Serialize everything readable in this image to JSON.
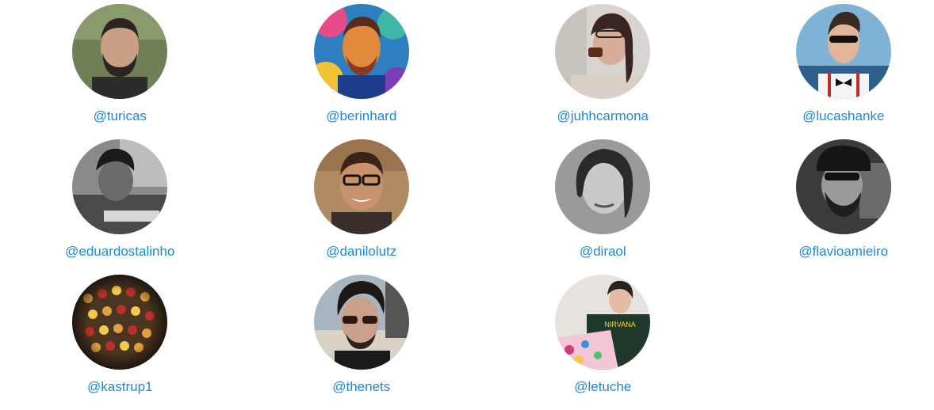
{
  "members": [
    {
      "handle": "@turicas",
      "avatar": "photo-bearded-man-outdoors",
      "bg": "#6f7f58",
      "skin": "#c9a084",
      "hair": "#2b2420"
    },
    {
      "handle": "@berinhard",
      "avatar": "psychedelic-portrait",
      "bg": "#2e7fc2",
      "skin": "#e08a3c",
      "hair": "#5b2a1a"
    },
    {
      "handle": "@juhhcarmona",
      "avatar": "photo-woman-drinking",
      "bg": "#d9d4cf",
      "skin": "#d6ad98",
      "hair": "#3a2520"
    },
    {
      "handle": "@lucashanke",
      "avatar": "photo-man-sunglasses-beach",
      "bg": "#7fb3d6",
      "skin": "#e2b49a",
      "hair": "#3b2a22"
    },
    {
      "handle": "@eduardostalinho",
      "avatar": "bw-photo-man-at-desk",
      "bg": "#8a8a8a",
      "skin": "#6a6a6a",
      "hair": "#1a1a1a"
    },
    {
      "handle": "@danilolutz",
      "avatar": "photo-smiling-man-glasses",
      "bg": "#b08a63",
      "skin": "#c8926c",
      "hair": "#3a2417"
    },
    {
      "handle": "@diraol",
      "avatar": "bw-photo-long-hair-man",
      "bg": "#9a9a9a",
      "skin": "#c9c9c9",
      "hair": "#2a2a2a"
    },
    {
      "handle": "@flavioamieiro",
      "avatar": "bw-photo-man-cap-sunglasses",
      "bg": "#3b3b3b",
      "skin": "#9a9a9a",
      "hair": "#151515"
    },
    {
      "handle": "@kastrup1",
      "avatar": "abstract-colorful-pattern",
      "bg": "#4a3520",
      "skin": "#e0a040",
      "hair": "#b8322a"
    },
    {
      "handle": "@thenets",
      "avatar": "photo-man-sunglasses-dark-hair",
      "bg": "#a8b6c2",
      "skin": "#caa08a",
      "hair": "#1b1816"
    },
    {
      "handle": "@letuche",
      "avatar": "photo-woman-laptop-stickers",
      "bg": "#e6e3df",
      "skin": "#e2bca6",
      "hair": "#2a2220"
    }
  ],
  "colors": {
    "link": "#1a8ad4",
    "background": "#ffffff"
  }
}
